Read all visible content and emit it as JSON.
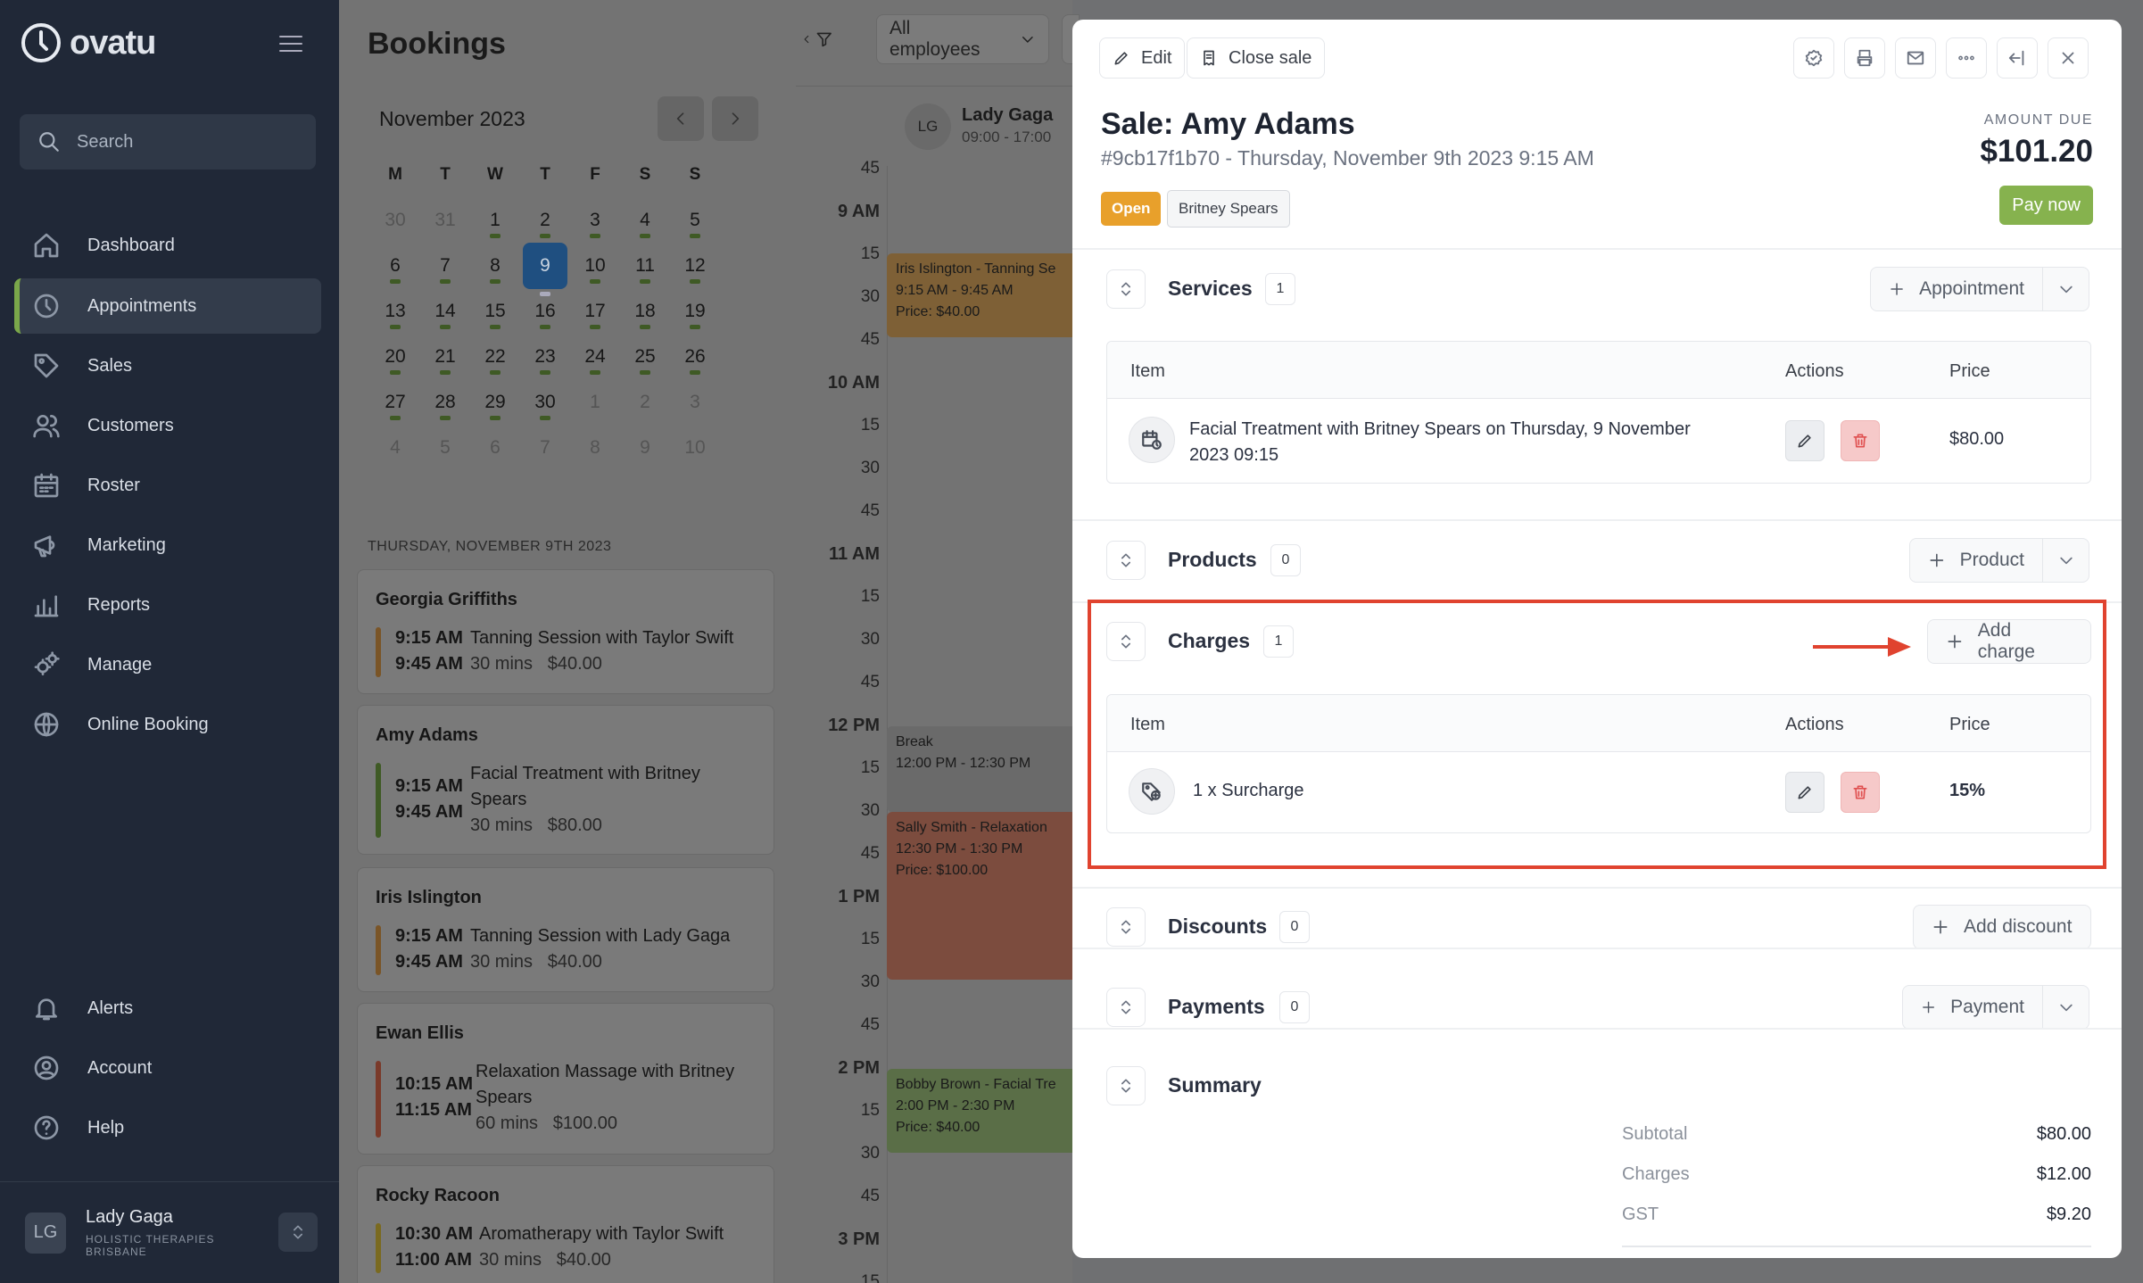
{
  "app": {
    "name": "ovatu"
  },
  "sidebar": {
    "search_placeholder": "Search",
    "items": [
      {
        "label": "Dashboard",
        "icon": "home-icon"
      },
      {
        "label": "Appointments",
        "icon": "clock-icon",
        "active": true
      },
      {
        "label": "Sales",
        "icon": "tag-icon"
      },
      {
        "label": "Customers",
        "icon": "users-icon"
      },
      {
        "label": "Roster",
        "icon": "calendar-icon"
      },
      {
        "label": "Marketing",
        "icon": "megaphone-icon"
      },
      {
        "label": "Reports",
        "icon": "chart-icon"
      },
      {
        "label": "Manage",
        "icon": "gears-icon"
      },
      {
        "label": "Online Booking",
        "icon": "globe-icon"
      }
    ],
    "bottom_items": [
      {
        "label": "Alerts",
        "icon": "bell-icon"
      },
      {
        "label": "Account",
        "icon": "account-icon"
      },
      {
        "label": "Help",
        "icon": "help-icon"
      }
    ],
    "user": {
      "initials": "LG",
      "name": "Lady Gaga",
      "business_line1": "HOLISTIC THERAPIES",
      "business_line2": "BRISBANE"
    }
  },
  "bookings": {
    "title": "Bookings",
    "month": "November 2023",
    "weekdays": [
      "M",
      "T",
      "W",
      "T",
      "F",
      "S",
      "S"
    ],
    "weeks": [
      [
        "30",
        "31",
        "1",
        "2",
        "3",
        "4",
        "5"
      ],
      [
        "6",
        "7",
        "8",
        "9",
        "10",
        "11",
        "12"
      ],
      [
        "13",
        "14",
        "15",
        "16",
        "17",
        "18",
        "19"
      ],
      [
        "20",
        "21",
        "22",
        "23",
        "24",
        "25",
        "26"
      ],
      [
        "27",
        "28",
        "29",
        "30",
        "1",
        "2",
        "3"
      ],
      [
        "4",
        "5",
        "6",
        "7",
        "8",
        "9",
        "10"
      ]
    ],
    "selected_day": "9",
    "day_label": "THURSDAY, NOVEMBER 9TH 2023",
    "list": [
      {
        "name": "Georgia Griffiths",
        "start": "9:15 AM",
        "end": "9:45 AM",
        "service": "Tanning Session with Taylor Swift",
        "duration": "30 mins",
        "price": "$40.00",
        "color": "#7a5527"
      },
      {
        "name": "Amy Adams",
        "start": "9:15 AM",
        "end": "9:45 AM",
        "service": "Facial Treatment with Britney Spears",
        "duration": "30 mins",
        "price": "$80.00",
        "color": "#3f5a25"
      },
      {
        "name": "Iris Islington",
        "start": "9:15 AM",
        "end": "9:45 AM",
        "service": "Tanning Session with Lady Gaga",
        "duration": "30 mins",
        "price": "$40.00",
        "color": "#7a5527"
      },
      {
        "name": "Ewan Ellis",
        "start": "10:15 AM",
        "end": "11:15 AM",
        "service": "Relaxation Massage with Britney Spears",
        "duration": "60 mins",
        "price": "$100.00",
        "color": "#7a3a2a"
      },
      {
        "name": "Rocky Racoon",
        "start": "10:30 AM",
        "end": "11:00 AM",
        "service": "Aromatherapy with Taylor Swift",
        "duration": "30 mins",
        "price": "$40.00",
        "color": "#7a6a20"
      }
    ]
  },
  "calendar": {
    "employee_filter": "All employees",
    "employee": {
      "initials": "LG",
      "name": "Lady Gaga",
      "hours": "09:00 - 17:00"
    },
    "time_labels": [
      "45",
      "9 AM",
      "15",
      "30",
      "45",
      "10 AM",
      "15",
      "30",
      "45",
      "11 AM",
      "15",
      "30",
      "45",
      "12 PM",
      "15",
      "30",
      "45",
      "1 PM",
      "15",
      "30",
      "45",
      "2 PM",
      "15",
      "30",
      "45",
      "3 PM",
      "15"
    ],
    "events": [
      {
        "title": "Iris Islington - Tanning Se",
        "time": "9:15 AM - 9:45 AM",
        "price": "Price: $40.00",
        "color": "#7e6036"
      },
      {
        "title": "Break",
        "time": "12:00 PM - 12:30 PM",
        "price": "",
        "color": "#6a6a6a"
      },
      {
        "title": "Sally Smith - Relaxation",
        "time": "12:30 PM - 1:30 PM",
        "price": "Price: $100.00",
        "color": "#7c4c3e"
      },
      {
        "title": "Bobby Brown - Facial Tre",
        "time": "2:00 PM - 2:30 PM",
        "price": "Price: $40.00",
        "color": "#5a6e47"
      }
    ]
  },
  "sale": {
    "toolbar": {
      "edit": "Edit",
      "close_sale": "Close sale"
    },
    "title": "Sale: Amy Adams",
    "subtitle": "#9cb17f1b70 - Thursday, November 9th 2023 9:15 AM",
    "status": "Open",
    "employee": "Britney Spears",
    "amount_due_label": "AMOUNT DUE",
    "amount_due": "$101.20",
    "pay_now": "Pay now",
    "services": {
      "title": "Services",
      "count": "1",
      "add_label": "Appointment",
      "columns": [
        "Item",
        "Actions",
        "Price"
      ],
      "rows": [
        {
          "line1": "Facial Treatment with Britney Spears on Thursday, 9 November",
          "line2": "2023 09:15",
          "price": "$80.00"
        }
      ]
    },
    "products": {
      "title": "Products",
      "count": "0",
      "add_label": "Product"
    },
    "charges": {
      "title": "Charges",
      "count": "1",
      "add_label": "Add charge",
      "columns": [
        "Item",
        "Actions",
        "Price"
      ],
      "rows": [
        {
          "item": "1 x Surcharge",
          "price": "15%"
        }
      ]
    },
    "discounts": {
      "title": "Discounts",
      "count": "0",
      "add_label": "Add discount"
    },
    "payments": {
      "title": "Payments",
      "count": "0",
      "add_label": "Payment"
    },
    "summary": {
      "title": "Summary",
      "rows": [
        {
          "label": "Subtotal",
          "value": "$80.00"
        },
        {
          "label": "Charges",
          "value": "$12.00"
        },
        {
          "label": "GST",
          "value": "$9.20"
        }
      ]
    }
  },
  "colors": {
    "accent_green": "#86b24e",
    "open_badge": "#e8a02b",
    "highlight": "#e0432f",
    "sidebar_bg": "#202837",
    "delete": "#e05050"
  }
}
